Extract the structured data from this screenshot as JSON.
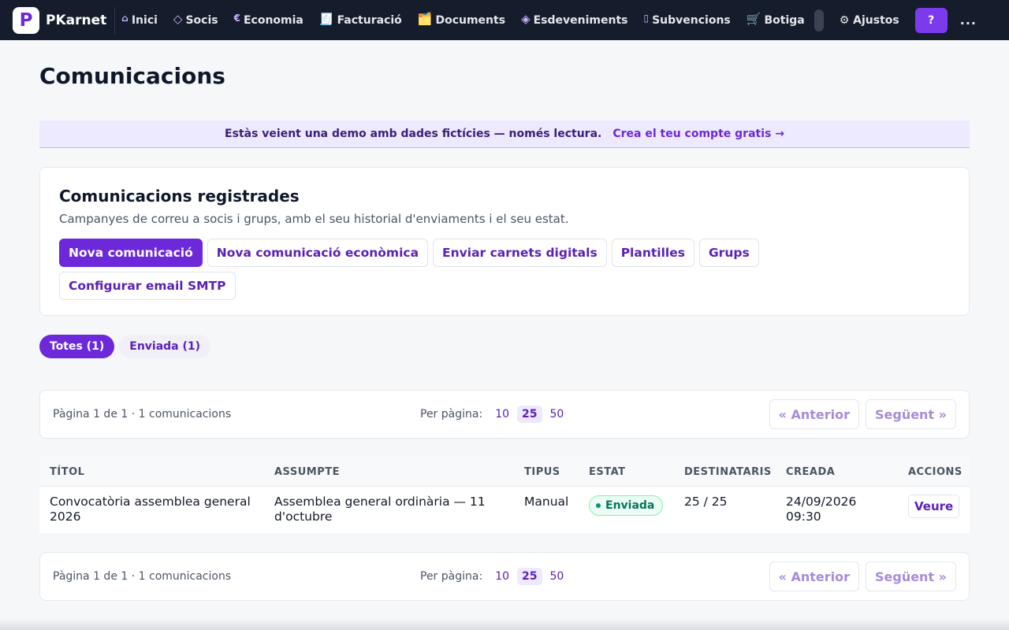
{
  "app": {
    "logo_letter": "P",
    "brand": "PKarnet"
  },
  "nav": {
    "items": [
      {
        "icon": "⌂",
        "label": "Inici"
      },
      {
        "icon": "◇",
        "label": "Socis"
      },
      {
        "icon": "€",
        "label": "Economia"
      },
      {
        "icon": "🧾",
        "label": "Facturació"
      },
      {
        "icon": "🗂️",
        "label": "Documents"
      },
      {
        "icon": "◈",
        "label": "Esdeveniments"
      },
      {
        "icon": "▯",
        "label": "Subvencions"
      },
      {
        "icon": "🛒",
        "label": "Botiga"
      }
    ],
    "settings_label": "⚙ Ajustos",
    "help_label": "?",
    "more_label": "..."
  },
  "page": {
    "title": "Comunicacions"
  },
  "banner": {
    "text": "Estàs veient una demo amb dades fictícies — només lectura.",
    "link": "Crea el teu compte gratis →"
  },
  "card": {
    "title": "Comunicacions registrades",
    "subtitle": "Campanyes de correu a socis i grups, amb el seu historial d'enviaments i el seu estat.",
    "buttons": [
      "Nova comunicació",
      "Nova comunicació econòmica",
      "Enviar carnets digitals",
      "Plantilles",
      "Grups",
      "Configurar email SMTP"
    ]
  },
  "tabs": [
    {
      "label": "Totes (1)",
      "active": true
    },
    {
      "label": "Enviada (1)",
      "active": false
    }
  ],
  "pager": {
    "info": "Pàgina 1 de 1 · 1 comunicacions",
    "per_page_label": "Per pàgina:",
    "options": [
      "10",
      "25",
      "50"
    ],
    "selected": "25",
    "prev": "« Anterior",
    "next": "Següent »"
  },
  "table": {
    "headers": [
      "TÍTOL",
      "ASSUMPTE",
      "TIPUS",
      "ESTAT",
      "DESTINATARIS",
      "CREADA",
      "ACCIONS"
    ],
    "rows": [
      {
        "title": "Convocatòria assemblea general 2026",
        "subject": "Assemblea general ordinària — 11 d'octubre",
        "type": "Manual",
        "status": "Enviada",
        "recipients": "25 / 25",
        "created": "24/09/2026 09:30",
        "action": "Veure"
      }
    ]
  },
  "colors": {
    "accent": "#6d28d9",
    "nav_bg": "#151c2c",
    "success": "#047857"
  }
}
